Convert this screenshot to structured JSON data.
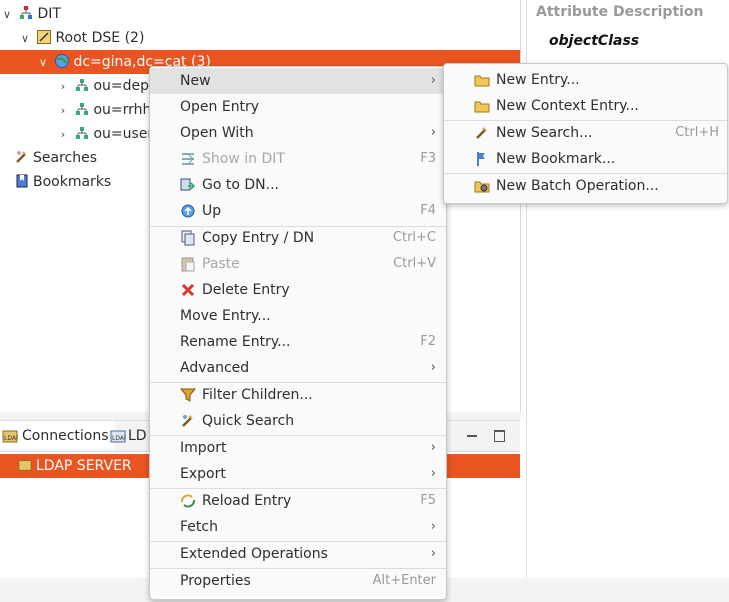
{
  "tree": {
    "root_label": "DIT",
    "root_dse_label": "Root DSE (2)",
    "selected_entry_label": "dc=gina,dc=cat (3)",
    "children": [
      {
        "label": "ou=depa"
      },
      {
        "label": "ou=rrhh ("
      },
      {
        "label": "ou=users"
      }
    ],
    "searches_label": "Searches",
    "bookmarks_label": "Bookmarks"
  },
  "attributes": {
    "header": "Attribute Description",
    "first_value": "objectClass"
  },
  "bottom": {
    "tabs": [
      {
        "label": "Connections"
      },
      {
        "label": "LD"
      }
    ],
    "connection": "LDAP SERVER"
  },
  "context_menu": {
    "items": [
      {
        "label": "New",
        "accel": "",
        "submenu": true
      },
      {
        "label": "Open Entry",
        "accel": ""
      },
      {
        "label": "Open With",
        "accel": "",
        "submenu": true
      },
      {
        "label": "Show in DIT",
        "accel": "F3"
      },
      {
        "label": "Go to DN...",
        "accel": ""
      },
      {
        "label": "Up",
        "accel": "F4"
      },
      {
        "label": "Copy Entry / DN",
        "accel": "Ctrl+C"
      },
      {
        "label": "Paste",
        "accel": "Ctrl+V"
      },
      {
        "label": "Delete Entry",
        "accel": ""
      },
      {
        "label": "Move Entry...",
        "accel": ""
      },
      {
        "label": "Rename Entry...",
        "accel": "F2"
      },
      {
        "label": "Advanced",
        "accel": "",
        "submenu": true
      },
      {
        "label": "Filter Children...",
        "accel": ""
      },
      {
        "label": "Quick Search",
        "accel": ""
      },
      {
        "label": "Import",
        "accel": "",
        "submenu": true
      },
      {
        "label": "Export",
        "accel": "",
        "submenu": true
      },
      {
        "label": "Reload Entry",
        "accel": "F5"
      },
      {
        "label": "Fetch",
        "accel": "",
        "submenu": true
      },
      {
        "label": "Extended Operations",
        "accel": "",
        "submenu": true
      },
      {
        "label": "Properties",
        "accel": "Alt+Enter"
      }
    ]
  },
  "new_submenu": {
    "items": [
      {
        "label": "New Entry...",
        "accel": ""
      },
      {
        "label": "New Context Entry...",
        "accel": ""
      },
      {
        "label": "New Search...",
        "accel": "Ctrl+H"
      },
      {
        "label": "New Bookmark...",
        "accel": ""
      },
      {
        "label": "New Batch Operation...",
        "accel": ""
      }
    ]
  },
  "colors": {
    "selection": "#e95420",
    "menu_hover": "#e2e2e2"
  }
}
